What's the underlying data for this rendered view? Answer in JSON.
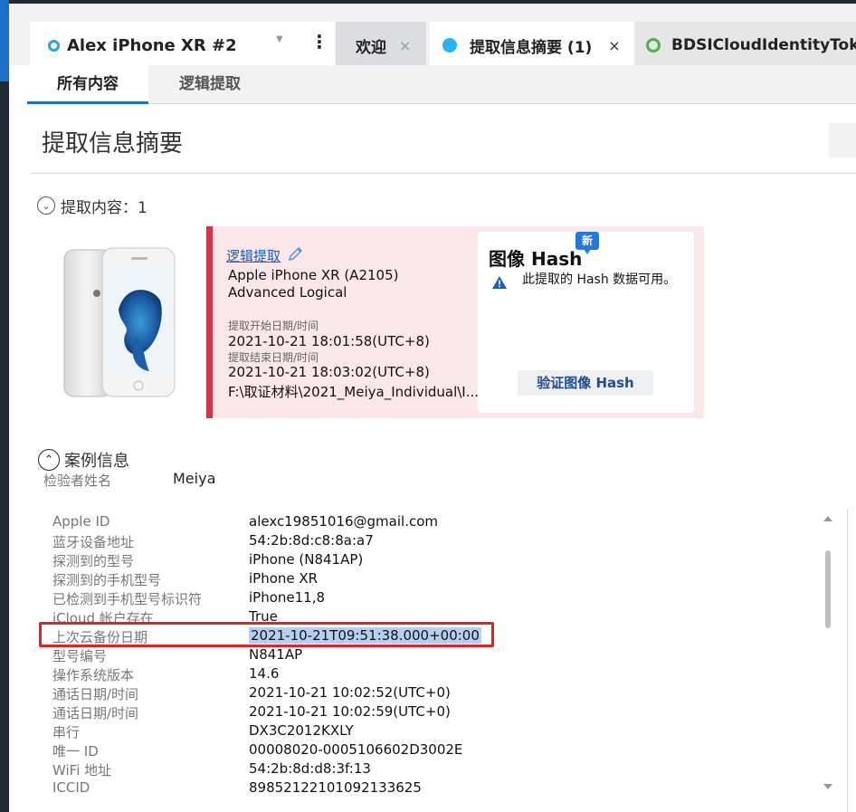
{
  "tabs": {
    "device": {
      "label": "Alex iPhone XR #2"
    },
    "welcome": {
      "label": "欢迎",
      "close": "×"
    },
    "summary": {
      "label": "提取信息摘要 (1)",
      "close": "×"
    },
    "bdsi": {
      "label": "BDSICloudIdentityToke"
    },
    "kebab": "⋮",
    "caret": "▼"
  },
  "subtabs": {
    "all_content": "所有内容",
    "logical_extraction": "逻辑提取"
  },
  "page_title": "提取信息摘要",
  "extraction_section": {
    "title": "提取内容：1",
    "toggle": "⌄"
  },
  "extraction": {
    "link": "逻辑提取",
    "device_model": "Apple iPhone XR (A2105)",
    "method": "Advanced Logical",
    "start_label": "提取开始日期/时间",
    "start_value": "2021-10-21 18:01:58(UTC+8)",
    "end_label": "提取结束日期/时间",
    "end_value": "2021-10-21 18:03:02(UTC+8)",
    "path": "F:\\取证材料\\2021_Meiya_Individual\\I..."
  },
  "hash": {
    "title": "图像 Hash",
    "badge": "新",
    "note": "此提取的 Hash 数据可用。",
    "verify_button": "验证图像 Hash"
  },
  "case_section": {
    "title": "案例信息",
    "toggle": "⌃"
  },
  "examiner": {
    "label": "检验者姓名",
    "value": "Meiya"
  },
  "details": [
    {
      "label": "Apple ID",
      "value": "alexc19851016@gmail.com"
    },
    {
      "label": "蓝牙设备地址",
      "value": "54:2b:8d:c8:8a:a7"
    },
    {
      "label": "探测到的型号",
      "value": "iPhone (N841AP)"
    },
    {
      "label": "探测到的手机型号",
      "value": "iPhone XR"
    },
    {
      "label": "已检测到手机型号标识符",
      "value": "iPhone11,8"
    },
    {
      "label": "iCloud 帐户存在",
      "value": "True"
    },
    {
      "label": "上次云备份日期",
      "value": "2021-10-21T09:51:38.000+00:00"
    },
    {
      "label": "型号编号",
      "value": "N841AP"
    },
    {
      "label": "操作系统版本",
      "value": "14.6"
    },
    {
      "label": "通话日期/时间",
      "value": "2021-10-21 10:02:52(UTC+0)"
    },
    {
      "label": "通话日期/时间",
      "value": "2021-10-21 10:02:59(UTC+0)"
    },
    {
      "label": "串行",
      "value": "DX3C2012KXLY"
    },
    {
      "label": "唯一 ID",
      "value": "00008020-0005106602D3002E"
    },
    {
      "label": "WiFi 地址",
      "value": "54:2b:8d:d8:3f:13"
    },
    {
      "label": "ICCID",
      "value": "89852122101092133625"
    }
  ],
  "colors": {
    "accent": "#1a6fc7",
    "extraction_bar": "#d8334a",
    "highlight": "#e02424",
    "selection": "#b3d0f3"
  }
}
